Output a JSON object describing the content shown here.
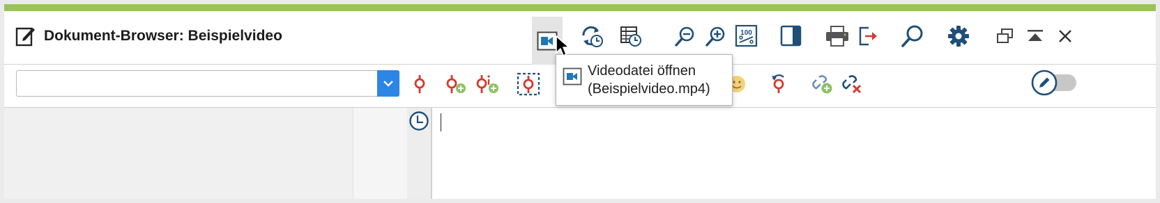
{
  "window": {
    "title": "Dokument-Browser: Beispielvideo",
    "accent_color": "#9bc25a"
  },
  "title_toolbar": {
    "icons": [
      "video-file-icon",
      "refresh-timestamp-icon",
      "timestamp-table-icon",
      "zoom-out-icon",
      "zoom-in-icon",
      "zoom-100-icon",
      "sidebar-toggle-icon",
      "print-icon",
      "export-icon",
      "search-icon",
      "settings-icon",
      "restore-window-icon",
      "collapse-icon",
      "close-icon"
    ],
    "zoom_label": "100"
  },
  "code_toolbar": {
    "combo_value": "",
    "icons": [
      "code-icon",
      "code-add-icon",
      "code-info-add-icon",
      "code-select-icon",
      "emoticon-icon",
      "code-undo-icon",
      "link-add-icon",
      "link-delete-icon"
    ]
  },
  "editor": {
    "text": ""
  },
  "tooltip": {
    "line1": "Videodatei öffnen",
    "line2": "(Beispielvideo.mp4)"
  },
  "edit_toggle": {
    "state": "off"
  },
  "colors": {
    "icon_blue": "#1f4e79",
    "dropdown_blue": "#2c86e3",
    "code_red": "#d33a2f",
    "add_green": "#8cc263"
  }
}
